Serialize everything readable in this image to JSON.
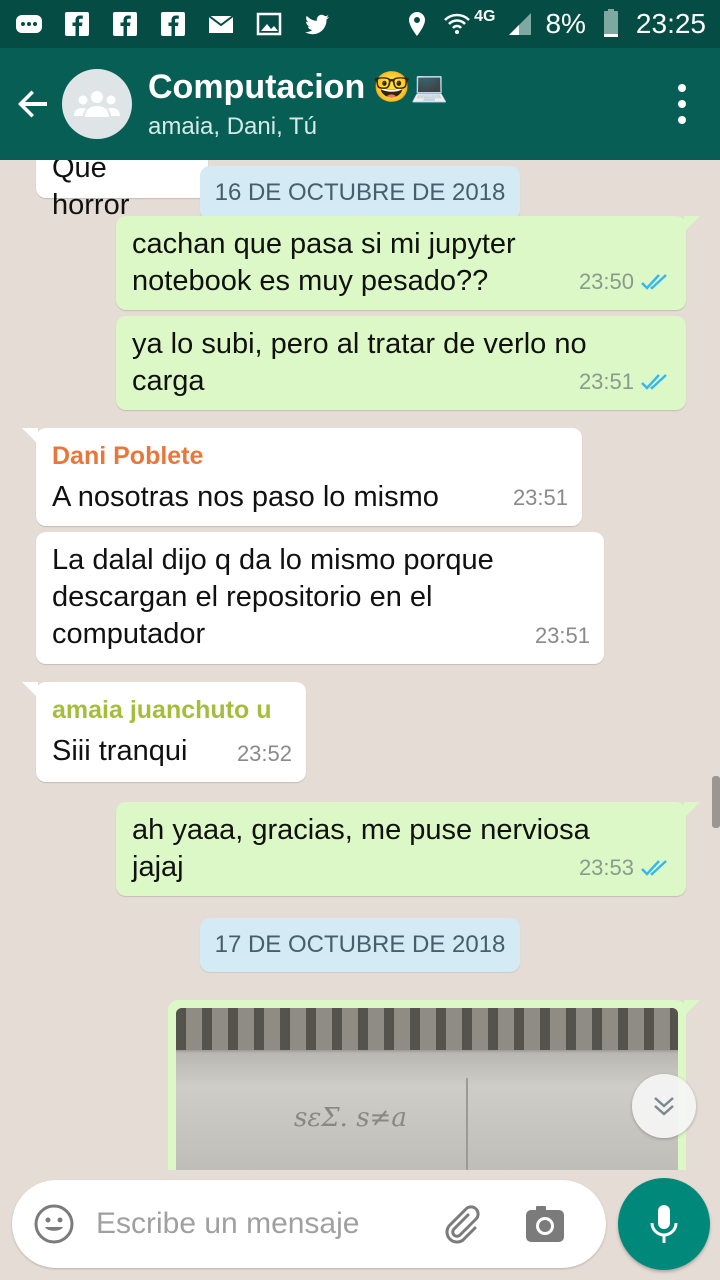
{
  "status_bar": {
    "icons": [
      "chat-icon",
      "facebook-icon",
      "facebook-icon",
      "facebook-icon",
      "mail-icon",
      "image-icon",
      "twitter-icon"
    ],
    "network": "4G",
    "battery": "8%",
    "time": "23:25"
  },
  "header": {
    "title": "Computacion",
    "title_emoji": "🤓💻",
    "subtitle": "amaia, Dani, Tú"
  },
  "chat": {
    "partial_message": "Que horror",
    "date_1": "16 DE OCTUBRE DE 2018",
    "messages": [
      {
        "from": "me",
        "text": "cachan que pasa si mi jupyter notebook es muy pesado??",
        "time": "23:50",
        "read": true
      },
      {
        "from": "me",
        "text": "ya lo subi, pero al tratar de verlo no carga",
        "time": "23:51",
        "read": true
      },
      {
        "from": "Dani Poblete",
        "text": "A nosotras nos paso lo mismo",
        "time": "23:51"
      },
      {
        "from": "Dani Poblete",
        "text": "La dalal dijo q da lo mismo porque descargan el repositorio en el computador",
        "time": "23:51"
      },
      {
        "from": "amaia juanchuto u",
        "text": "Siii tranqui",
        "time": "23:52"
      },
      {
        "from": "me",
        "text": "ah yaaa, gracias, me puse nerviosa jajaj",
        "time": "23:53",
        "read": true
      }
    ],
    "date_2": "17 DE OCTUBRE DE 2018",
    "photo_text": "sεΣ. s≠a"
  },
  "composer": {
    "placeholder": "Escribe un mensaje"
  },
  "colors": {
    "header": "#075e54",
    "status_bar": "#054d44",
    "outgoing": "#dcf8c6",
    "incoming": "#ffffff",
    "sender_dani": "#e8773b",
    "sender_amaia": "#a6bd3c",
    "tick_read": "#34b7f1",
    "mic": "#00897b"
  }
}
